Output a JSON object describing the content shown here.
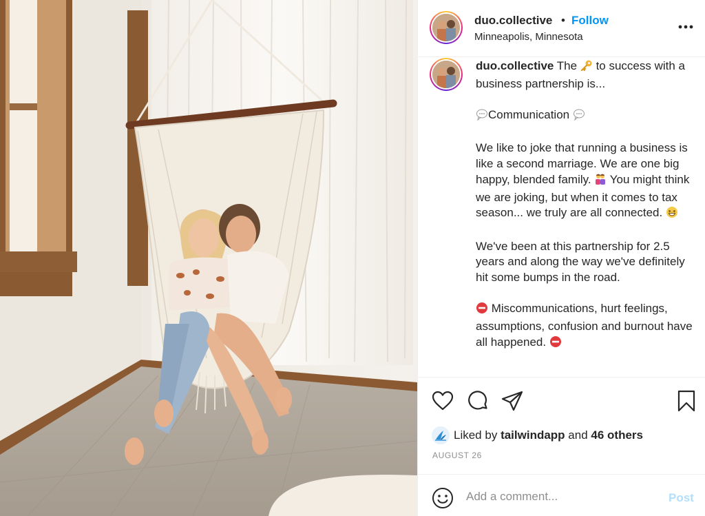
{
  "post": {
    "username": "duo.collective",
    "separator": "•",
    "follow_label": "Follow",
    "location": "Minneapolis, Minnesota"
  },
  "caption": {
    "username": "duo.collective",
    "line1_pre": "The",
    "line1_post": "to success with a business partnership is...",
    "comm_label": "Communication",
    "para2_pre": "We like to joke that running a business is like a second marriage. We are one big happy, blended family.",
    "para2_mid": "You might think we are joking, but when it comes to tax season... we truly are all connected.",
    "para3": "We've been at this partnership for 2.5 years and along the way we've definitely hit some bumps in the road.",
    "para4": "Miscommunications, hurt feelings, assumptions, confusion and burnout have all happened."
  },
  "likes": {
    "prefix": "Liked by",
    "user": "tailwindapp",
    "middle": "and",
    "others": "46 others"
  },
  "date": "AUGUST 26",
  "comment": {
    "placeholder": "Add a comment...",
    "post_label": "Post"
  },
  "icons": [
    "more-icon",
    "heart-icon",
    "comment-icon",
    "share-icon",
    "bookmark-icon",
    "emoji-icon",
    "key-emoji",
    "speech-bubble-emoji",
    "family-emoji",
    "grin-emoji",
    "no-entry-emoji"
  ],
  "colors": {
    "accent": "#0095f6",
    "post_disabled": "#b2dffc",
    "muted": "#8e8e8e",
    "text": "#262626"
  }
}
